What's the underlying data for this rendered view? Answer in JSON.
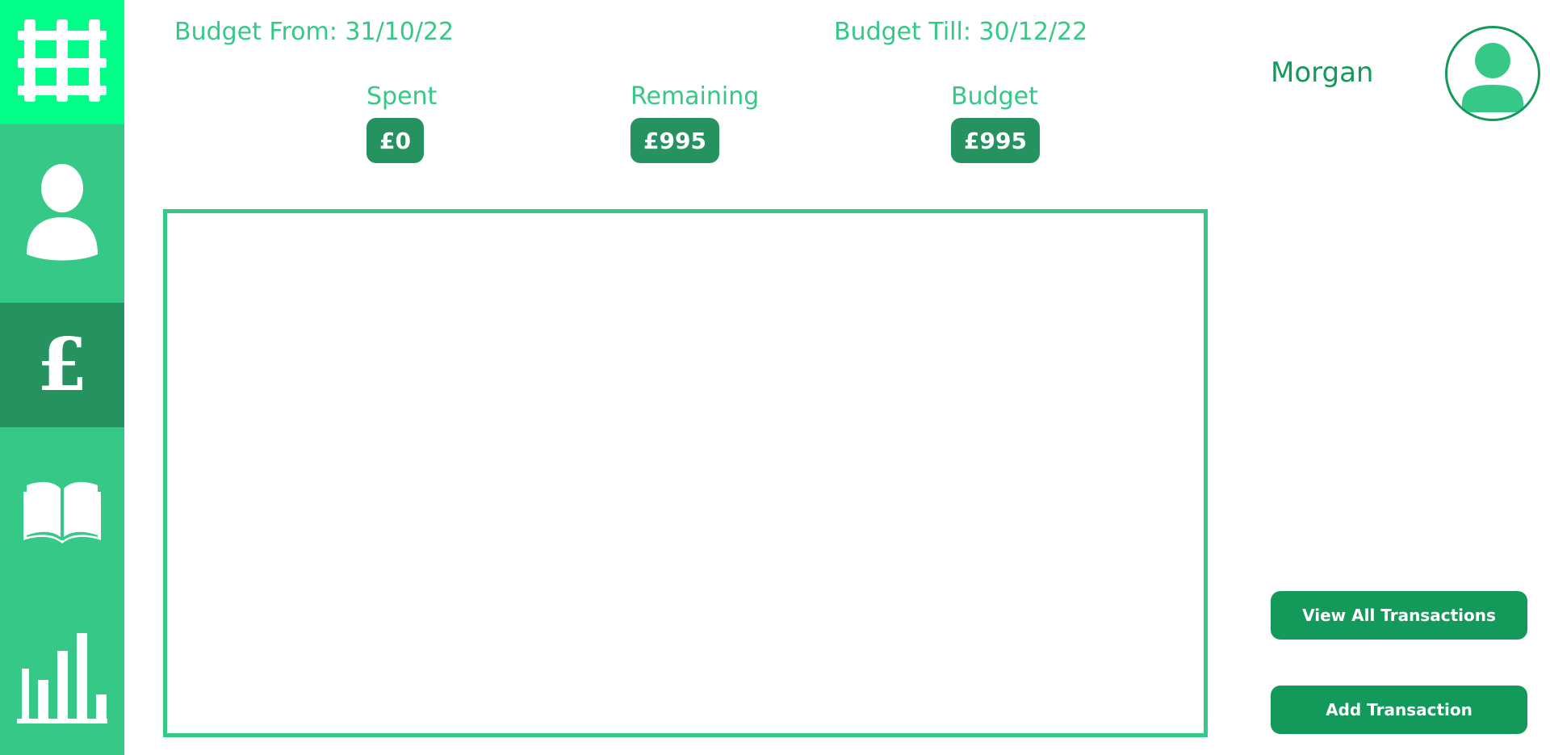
{
  "colors": {
    "sidebar": "#36c886",
    "sidebar_logo": "#00ff88",
    "sidebar_active": "#25925f",
    "accent": "#36c886",
    "dark_accent": "#25925f",
    "button": "#13995a"
  },
  "sidebar": {
    "items": [
      {
        "icon": "railway-track-icon",
        "active": false
      },
      {
        "icon": "user-icon",
        "active": false
      },
      {
        "icon": "pound-sign-icon",
        "active": true
      },
      {
        "icon": "open-book-icon",
        "active": false
      },
      {
        "icon": "bar-chart-icon",
        "active": false
      }
    ]
  },
  "header": {
    "budget_from": "Budget From: 31/10/22",
    "budget_till": "Budget Till: 30/12/22"
  },
  "stats": {
    "spent": {
      "label": "Spent",
      "value": "£0"
    },
    "remaining": {
      "label": "Remaining",
      "value": "£995"
    },
    "budget": {
      "label": "Budget",
      "value": "£995"
    }
  },
  "user": {
    "name": "Morgan",
    "avatar_icon": "user-avatar-icon"
  },
  "actions": {
    "view_all": "View All Transactions",
    "add": "Add Transaction"
  }
}
